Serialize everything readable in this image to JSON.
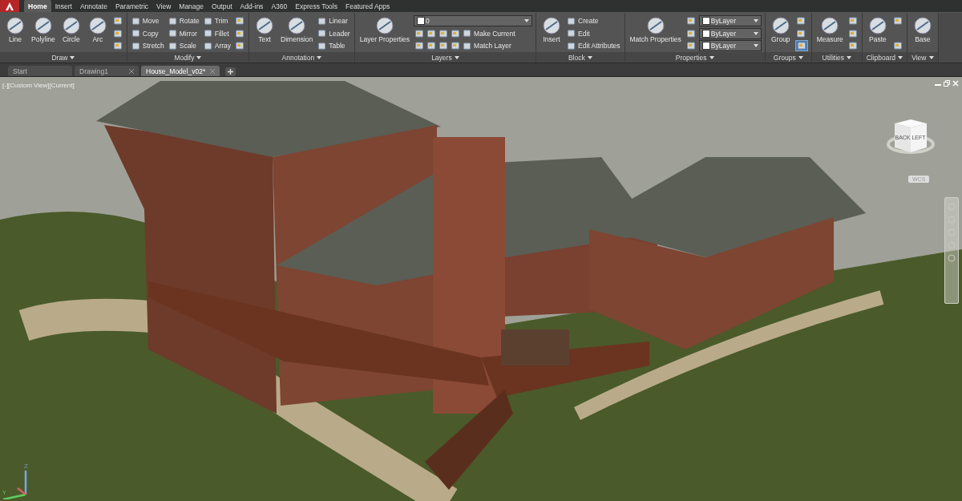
{
  "ribbon_tabs": [
    {
      "label": "Home",
      "selected": true
    },
    {
      "label": "Insert",
      "selected": false
    },
    {
      "label": "Annotate",
      "selected": false
    },
    {
      "label": "Parametric",
      "selected": false
    },
    {
      "label": "View",
      "selected": false
    },
    {
      "label": "Manage",
      "selected": false
    },
    {
      "label": "Output",
      "selected": false
    },
    {
      "label": "Add-ins",
      "selected": false
    },
    {
      "label": "A360",
      "selected": false
    },
    {
      "label": "Express Tools",
      "selected": false
    },
    {
      "label": "Featured Apps",
      "selected": false
    }
  ],
  "panels": [
    {
      "title": "Draw",
      "columns": [
        [
          {
            "kind": "large",
            "label": "Line"
          }
        ],
        [
          {
            "kind": "large",
            "label": "Polyline"
          }
        ],
        [
          {
            "kind": "large",
            "label": "Circle"
          }
        ],
        [
          {
            "kind": "large",
            "label": "Arc"
          }
        ],
        [
          {
            "kind": "icon"
          },
          {
            "kind": "icon"
          },
          {
            "kind": "icon"
          }
        ]
      ]
    },
    {
      "title": "Modify",
      "columns": [
        [
          {
            "kind": "small",
            "label": "Move"
          },
          {
            "kind": "small",
            "label": "Copy"
          },
          {
            "kind": "small",
            "label": "Stretch"
          }
        ],
        [
          {
            "kind": "small",
            "label": "Rotate"
          },
          {
            "kind": "small",
            "label": "Mirror"
          },
          {
            "kind": "small",
            "label": "Scale"
          }
        ],
        [
          {
            "kind": "small",
            "label": "Trim"
          },
          {
            "kind": "small",
            "label": "Fillet"
          },
          {
            "kind": "small",
            "label": "Array"
          }
        ],
        [
          {
            "kind": "icon"
          },
          {
            "kind": "icon"
          },
          {
            "kind": "icon"
          }
        ]
      ]
    },
    {
      "title": "Annotation",
      "columns": [
        [
          {
            "kind": "large",
            "label": "Text"
          }
        ],
        [
          {
            "kind": "large",
            "label": "Dimension"
          }
        ],
        [
          {
            "kind": "small",
            "label": "Linear"
          },
          {
            "kind": "small",
            "label": "Leader"
          },
          {
            "kind": "small",
            "label": "Table"
          }
        ]
      ]
    },
    {
      "title": "Layers",
      "columns": [
        [
          {
            "kind": "large",
            "label": "Layer Properties"
          }
        ],
        [
          {
            "kind": "dropdown",
            "value": "0"
          },
          {
            "kind": "row",
            "items": [
              {
                "kind": "icon"
              },
              {
                "kind": "icon"
              },
              {
                "kind": "icon"
              },
              {
                "kind": "icon"
              },
              {
                "kind": "small",
                "label": "Make Current"
              }
            ]
          },
          {
            "kind": "row",
            "items": [
              {
                "kind": "icon"
              },
              {
                "kind": "icon"
              },
              {
                "kind": "icon"
              },
              {
                "kind": "icon"
              },
              {
                "kind": "small",
                "label": "Match Layer"
              }
            ]
          }
        ]
      ]
    },
    {
      "title": "Block",
      "columns": [
        [
          {
            "kind": "large",
            "label": "Insert"
          }
        ],
        [
          {
            "kind": "small",
            "label": "Create"
          },
          {
            "kind": "small",
            "label": "Edit"
          },
          {
            "kind": "small",
            "label": "Edit Attributes"
          }
        ]
      ]
    },
    {
      "title": "Properties",
      "columns": [
        [
          {
            "kind": "large",
            "label": "Match Properties"
          }
        ],
        [
          {
            "kind": "icon"
          },
          {
            "kind": "icon"
          },
          {
            "kind": "icon"
          }
        ],
        [
          {
            "kind": "dropdown",
            "value": "ByLayer"
          },
          {
            "kind": "dropdown",
            "value": "ByLayer"
          },
          {
            "kind": "dropdown",
            "value": "ByLayer"
          }
        ]
      ]
    },
    {
      "title": "Groups",
      "columns": [
        [
          {
            "kind": "large",
            "label": "Group"
          }
        ],
        [
          {
            "kind": "icon",
            "on": false
          },
          {
            "kind": "icon",
            "on": false
          },
          {
            "kind": "icon",
            "on": true
          }
        ]
      ]
    },
    {
      "title": "Utilities",
      "columns": [
        [
          {
            "kind": "large",
            "label": "Measure"
          }
        ],
        [
          {
            "kind": "icon"
          },
          {
            "kind": "icon"
          },
          {
            "kind": "icon"
          }
        ]
      ]
    },
    {
      "title": "Clipboard",
      "columns": [
        [
          {
            "kind": "large",
            "label": "Paste"
          }
        ],
        [
          {
            "kind": "icon"
          },
          {
            "kind": "icon"
          }
        ]
      ]
    },
    {
      "title": "View",
      "columns": [
        [
          {
            "kind": "large",
            "label": "Base"
          }
        ]
      ]
    }
  ],
  "doc_tabs": [
    {
      "label": "Start",
      "selected": false,
      "closable": false
    },
    {
      "label": "Drawing1",
      "selected": false,
      "closable": true
    },
    {
      "label": "House_Model_v02*",
      "selected": true,
      "closable": true
    }
  ],
  "viewport": {
    "label": "[-][Custom View][Current]",
    "viewcube": {
      "faces": [
        "BACK",
        "LEFT"
      ],
      "ucs": "WCS"
    },
    "ucs_icon": {
      "axes": [
        "Z",
        "Y"
      ]
    }
  }
}
